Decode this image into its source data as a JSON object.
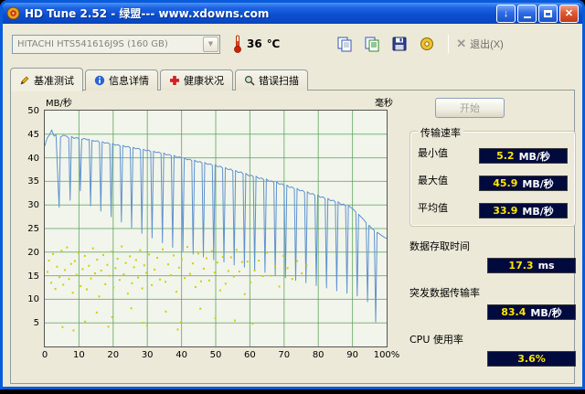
{
  "window": {
    "title": "HD Tune 2.52 - 绿盟--- www.xdowns.com"
  },
  "toolbar": {
    "drive": "HITACHI HTS541616J9S (160 GB)",
    "temperature": "36",
    "temp_unit": "℃",
    "exit_label": "退出(X)"
  },
  "tabs": [
    {
      "label": "基准测试"
    },
    {
      "label": "信息详情"
    },
    {
      "label": "健康状况"
    },
    {
      "label": "错误扫描"
    }
  ],
  "panel": {
    "start_label": "开始",
    "transfer_group": "传输速率",
    "min_label": "最小值",
    "min_value": "5.2",
    "min_unit": "MB/秒",
    "max_label": "最大值",
    "max_value": "45.9",
    "max_unit": "MB/秒",
    "avg_label": "平均值",
    "avg_value": "33.9",
    "avg_unit": "MB/秒",
    "access_label": "数据存取时间",
    "access_value": "17.3",
    "access_unit": "ms",
    "burst_label": "突发数据传输率",
    "burst_value": "83.4",
    "burst_unit": "MB/秒",
    "cpu_label": "CPU 使用率",
    "cpu_value": "3.6%"
  },
  "chart_data": {
    "type": "line+scatter",
    "x_axis": {
      "range": [
        0,
        100
      ],
      "ticks": [
        "0",
        "10",
        "20",
        "30",
        "40",
        "50",
        "60",
        "70",
        "80",
        "90",
        "100%"
      ]
    },
    "y_axis_left": {
      "title": "MB/秒",
      "range": [
        0,
        50
      ],
      "ticks": [
        50,
        45,
        40,
        35,
        30,
        25,
        20,
        15,
        10,
        5
      ]
    },
    "y_axis_right": {
      "title": "毫秒"
    },
    "grid": {
      "color": "#55A055",
      "bg": "#F2F5EC"
    },
    "series": [
      {
        "name": "transfer_rate",
        "type": "line",
        "color": "#5F92CF",
        "points": [
          [
            0,
            42.5
          ],
          [
            0.7,
            44.2
          ],
          [
            1.5,
            45.0
          ],
          [
            2,
            45.9
          ],
          [
            2.7,
            44.6
          ],
          [
            3.3,
            44.9
          ],
          [
            3.8,
            36.0
          ],
          [
            4.2,
            29.5
          ],
          [
            4.6,
            44.4
          ],
          [
            5.5,
            44.8
          ],
          [
            6.3,
            44.6
          ],
          [
            7,
            44.2
          ],
          [
            7.4,
            31.0
          ],
          [
            7.8,
            44.5
          ],
          [
            8.6,
            44.1
          ],
          [
            9.4,
            44.3
          ],
          [
            10,
            44.0
          ],
          [
            10.4,
            33.0
          ],
          [
            10.8,
            43.9
          ],
          [
            11.6,
            44.1
          ],
          [
            12.4,
            43.8
          ],
          [
            13,
            43.9
          ],
          [
            13.4,
            29.8
          ],
          [
            13.8,
            43.7
          ],
          [
            14.6,
            43.5
          ],
          [
            15.4,
            43.6
          ],
          [
            16,
            43.3
          ],
          [
            16.4,
            28.7
          ],
          [
            16.8,
            43.4
          ],
          [
            17.6,
            43.1
          ],
          [
            18.4,
            43.2
          ],
          [
            19,
            42.9
          ],
          [
            19.4,
            27.5
          ],
          [
            19.8,
            43.0
          ],
          [
            20.6,
            42.7
          ],
          [
            21.4,
            42.8
          ],
          [
            22,
            42.5
          ],
          [
            22.4,
            26.4
          ],
          [
            22.8,
            42.6
          ],
          [
            23.6,
            42.3
          ],
          [
            24.4,
            42.4
          ],
          [
            25,
            42.1
          ],
          [
            25.4,
            25.2
          ],
          [
            25.8,
            42.2
          ],
          [
            26.6,
            41.9
          ],
          [
            27.4,
            42.0
          ],
          [
            28,
            41.7
          ],
          [
            28.4,
            24.0
          ],
          [
            28.8,
            41.8
          ],
          [
            29.6,
            41.5
          ],
          [
            30.4,
            41.6
          ],
          [
            31,
            41.3
          ],
          [
            31.4,
            23.0
          ],
          [
            31.8,
            41.4
          ],
          [
            32.6,
            41.1
          ],
          [
            33.4,
            41.2
          ],
          [
            34,
            40.9
          ],
          [
            34.4,
            22.0
          ],
          [
            34.8,
            41.0
          ],
          [
            35.6,
            40.6
          ],
          [
            36.4,
            40.7
          ],
          [
            37,
            40.4
          ],
          [
            37.4,
            21.0
          ],
          [
            37.8,
            40.5
          ],
          [
            38.6,
            40.1
          ],
          [
            39.4,
            40.2
          ],
          [
            40,
            39.9
          ],
          [
            40.4,
            20.2
          ],
          [
            40.8,
            40.0
          ],
          [
            41.6,
            39.6
          ],
          [
            42.4,
            39.7
          ],
          [
            43,
            39.4
          ],
          [
            43.4,
            19.6
          ],
          [
            43.8,
            39.5
          ],
          [
            44.6,
            39.1
          ],
          [
            45.4,
            39.2
          ],
          [
            46,
            38.9
          ],
          [
            46.4,
            19.0
          ],
          [
            46.8,
            39.0
          ],
          [
            47.6,
            38.6
          ],
          [
            48.4,
            38.7
          ],
          [
            49,
            38.4
          ],
          [
            49.4,
            18.4
          ],
          [
            49.8,
            38.5
          ],
          [
            50.6,
            38.1
          ],
          [
            51.4,
            38.2
          ],
          [
            52,
            37.8
          ],
          [
            52.4,
            17.9
          ],
          [
            52.8,
            37.9
          ],
          [
            53.6,
            37.5
          ],
          [
            54.4,
            37.6
          ],
          [
            55,
            37.2
          ],
          [
            55.4,
            17.3
          ],
          [
            55.8,
            37.3
          ],
          [
            56.6,
            36.9
          ],
          [
            57.4,
            37.0
          ],
          [
            58,
            36.6
          ],
          [
            58.4,
            16.8
          ],
          [
            58.8,
            36.7
          ],
          [
            59.6,
            36.2
          ],
          [
            60.4,
            36.3
          ],
          [
            61,
            36.0
          ],
          [
            61.4,
            16.2
          ],
          [
            61.8,
            36.1
          ],
          [
            62.6,
            35.6
          ],
          [
            63.4,
            35.7
          ],
          [
            64,
            35.4
          ],
          [
            64.4,
            15.7
          ],
          [
            64.8,
            35.5
          ],
          [
            65.6,
            35.0
          ],
          [
            66.4,
            35.1
          ],
          [
            67,
            34.8
          ],
          [
            67.4,
            15.1
          ],
          [
            67.8,
            34.9
          ],
          [
            68.6,
            34.4
          ],
          [
            69.4,
            34.5
          ],
          [
            70,
            34.1
          ],
          [
            70.4,
            14.6
          ],
          [
            70.8,
            34.2
          ],
          [
            71.6,
            33.7
          ],
          [
            72.4,
            33.8
          ],
          [
            73,
            33.4
          ],
          [
            73.4,
            14.0
          ],
          [
            73.8,
            33.5
          ],
          [
            74.6,
            33.0
          ],
          [
            75.4,
            33.1
          ],
          [
            76,
            32.7
          ],
          [
            76.4,
            13.5
          ],
          [
            76.8,
            32.8
          ],
          [
            77.6,
            32.3
          ],
          [
            78.4,
            32.4
          ],
          [
            79,
            32.0
          ],
          [
            79.4,
            12.9
          ],
          [
            79.8,
            32.1
          ],
          [
            80.6,
            31.6
          ],
          [
            81.4,
            31.7
          ],
          [
            82,
            31.3
          ],
          [
            82.4,
            12.4
          ],
          [
            82.8,
            31.4
          ],
          [
            83.6,
            30.9
          ],
          [
            84.4,
            31.0
          ],
          [
            85,
            30.6
          ],
          [
            85.4,
            11.8
          ],
          [
            85.8,
            30.7
          ],
          [
            86.6,
            30.1
          ],
          [
            87.4,
            30.2
          ],
          [
            88,
            29.8
          ],
          [
            88.4,
            11.3
          ],
          [
            88.8,
            29.9
          ],
          [
            89.6,
            29.4
          ],
          [
            90.4,
            29.0
          ],
          [
            91,
            28.5
          ],
          [
            91.4,
            10.7
          ],
          [
            91.8,
            28.0
          ],
          [
            92.6,
            27.4
          ],
          [
            93.4,
            26.8
          ],
          [
            94,
            26.2
          ],
          [
            94.4,
            9.5
          ],
          [
            94.8,
            25.7
          ],
          [
            95.6,
            25.1
          ],
          [
            96.4,
            24.6
          ],
          [
            96.8,
            5.2
          ],
          [
            97.2,
            24.2
          ],
          [
            98,
            23.8
          ],
          [
            98.8,
            23.4
          ],
          [
            99.4,
            23.1
          ],
          [
            100,
            22.9
          ]
        ]
      },
      {
        "name": "access_time",
        "type": "scatter",
        "color": "#CFCF00",
        "points": [
          [
            0.8,
            15.8
          ],
          [
            1.2,
            18.2
          ],
          [
            1.9,
            13.5
          ],
          [
            2.4,
            19.6
          ],
          [
            3.1,
            12.2
          ],
          [
            3.6,
            16.9
          ],
          [
            4.3,
            14.7
          ],
          [
            4.9,
            20.3
          ],
          [
            5.4,
            13.1
          ],
          [
            5.9,
            16.2
          ],
          [
            6.5,
            21.0
          ],
          [
            7.1,
            14.3
          ],
          [
            7.7,
            17.5
          ],
          [
            8.2,
            11.4
          ],
          [
            8.8,
            18.1
          ],
          [
            9.3,
            15.2
          ],
          [
            9.9,
            19.8
          ],
          [
            10.5,
            12.8
          ],
          [
            11.1,
            16.4
          ],
          [
            11.7,
            19.2
          ],
          [
            12.3,
            12.1
          ],
          [
            12.9,
            17.1
          ],
          [
            13.5,
            14.4
          ],
          [
            14.1,
            20.8
          ],
          [
            14.7,
            15.5
          ],
          [
            15.3,
            18.4
          ],
          [
            15.9,
            10.6
          ],
          [
            16.5,
            16.1
          ],
          [
            17.1,
            19.4
          ],
          [
            17.7,
            13.2
          ],
          [
            18.3,
            17.3
          ],
          [
            18.9,
            15.0
          ],
          [
            19.5,
            20.1
          ],
          [
            20.1,
            12.5
          ],
          [
            20.7,
            16.6
          ],
          [
            21.3,
            18.6
          ],
          [
            21.9,
            14.1
          ],
          [
            22.5,
            21.2
          ],
          [
            23.1,
            15.3
          ],
          [
            23.7,
            17.7
          ],
          [
            24.3,
            11.2
          ],
          [
            24.9,
            19.1
          ],
          [
            25.5,
            13.4
          ],
          [
            26.1,
            16.8
          ],
          [
            26.7,
            18.3
          ],
          [
            27.3,
            14.6
          ],
          [
            27.9,
            20.4
          ],
          [
            28.5,
            12.3
          ],
          [
            29.1,
            17.2
          ],
          [
            29.7,
            15.6
          ],
          [
            30.5,
            19.5
          ],
          [
            31.3,
            13.0
          ],
          [
            32.1,
            16.3
          ],
          [
            32.9,
            18.8
          ],
          [
            33.7,
            14.2
          ],
          [
            34.5,
            20.6
          ],
          [
            35.3,
            13.7
          ],
          [
            36.1,
            17.4
          ],
          [
            36.9,
            15.1
          ],
          [
            37.7,
            19.3
          ],
          [
            38.5,
            11.6
          ],
          [
            39.3,
            16.7
          ],
          [
            40.1,
            18.5
          ],
          [
            40.9,
            14.5
          ],
          [
            41.7,
            21.1
          ],
          [
            42.5,
            15.4
          ],
          [
            43.3,
            17.6
          ],
          [
            44.1,
            12.6
          ],
          [
            44.9,
            19.7
          ],
          [
            45.7,
            13.8
          ],
          [
            46.5,
            16.5
          ],
          [
            47.3,
            18.7
          ],
          [
            48.1,
            14.0
          ],
          [
            48.9,
            20.2
          ],
          [
            49.7,
            15.7
          ],
          [
            50.5,
            17.8
          ],
          [
            51.3,
            11.9
          ],
          [
            52.1,
            19.0
          ],
          [
            52.9,
            13.3
          ],
          [
            53.7,
            16.0
          ],
          [
            54.5,
            18.9
          ],
          [
            55.3,
            14.8
          ],
          [
            56.1,
            20.5
          ],
          [
            56.9,
            15.9
          ],
          [
            57.7,
            17.9
          ],
          [
            58.5,
            11.1
          ],
          [
            59.3,
            18.0
          ],
          [
            60.2,
            13.6
          ],
          [
            61.4,
            16.1
          ],
          [
            62.6,
            18.2
          ],
          [
            63.8,
            14.9
          ],
          [
            65.0,
            19.9
          ],
          [
            66.2,
            15.0
          ],
          [
            67.4,
            17.0
          ],
          [
            68.6,
            12.7
          ],
          [
            69.8,
            19.2
          ],
          [
            71.0,
            16.6
          ],
          [
            72.4,
            14.3
          ],
          [
            73.8,
            18.1
          ],
          [
            75.2,
            15.5
          ],
          [
            76.6,
            17.2
          ],
          [
            5.2,
            4.1
          ],
          [
            11.8,
            5.3
          ],
          [
            19.7,
            6.2
          ],
          [
            29.9,
            4.4
          ],
          [
            39.8,
            5.1
          ],
          [
            49.9,
            6.0
          ],
          [
            15.2,
            7.2
          ],
          [
            25.3,
            8.1
          ],
          [
            35.4,
            7.4
          ],
          [
            45.5,
            8.0
          ],
          [
            55.6,
            5.5
          ],
          [
            8.4,
            3.4
          ],
          [
            18.6,
            4.2
          ],
          [
            28.7,
            5.0
          ],
          [
            38.9,
            3.6
          ],
          [
            60.8,
            4.8
          ]
        ]
      }
    ]
  }
}
